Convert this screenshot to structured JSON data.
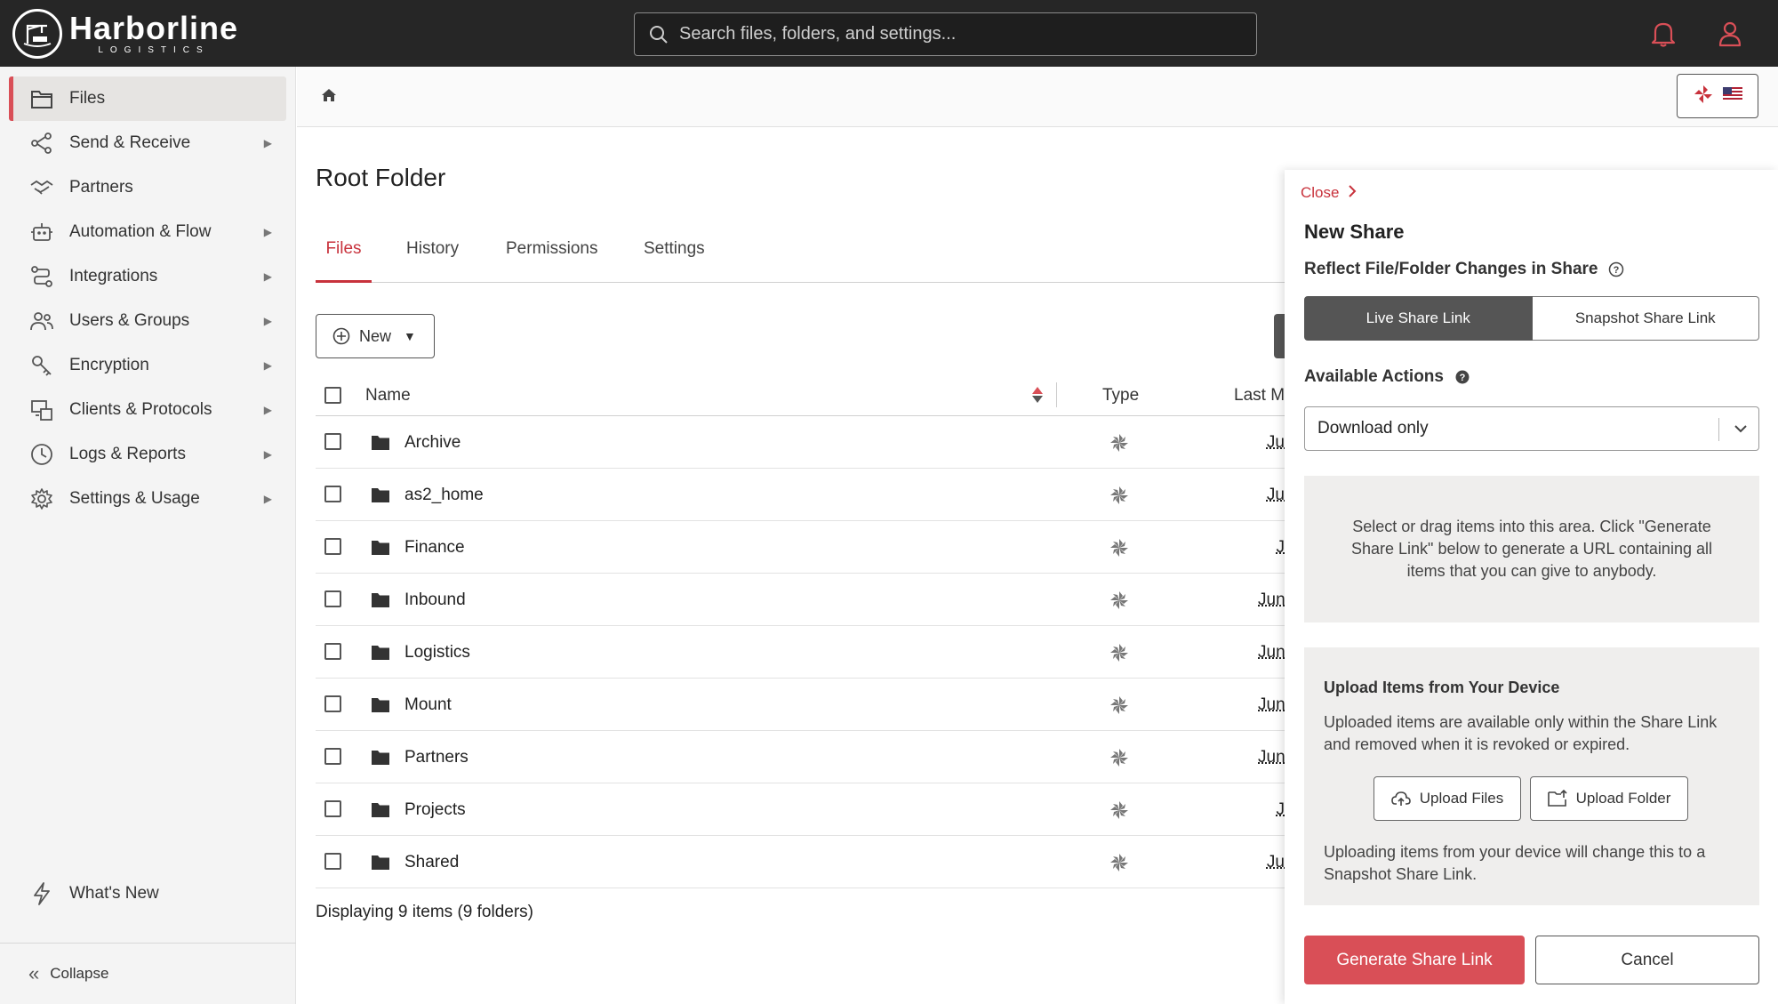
{
  "brand": {
    "name": "Harborline",
    "tagline": "LOGISTICS"
  },
  "search": {
    "placeholder": "Search files, folders, and settings..."
  },
  "header": {
    "icons": [
      "bell-icon",
      "user-icon"
    ],
    "accent": "#d94f57"
  },
  "sidebar": {
    "items": [
      {
        "label": "Files",
        "icon": "folder-icon",
        "active": true,
        "has_arrow": false
      },
      {
        "label": "Send & Receive",
        "icon": "share-nodes-icon",
        "has_arrow": true
      },
      {
        "label": "Partners",
        "icon": "handshake-icon",
        "has_arrow": false
      },
      {
        "label": "Automation & Flow",
        "icon": "robot-icon",
        "has_arrow": true
      },
      {
        "label": "Integrations",
        "icon": "integration-icon",
        "has_arrow": true
      },
      {
        "label": "Users & Groups",
        "icon": "users-icon",
        "has_arrow": true
      },
      {
        "label": "Encryption",
        "icon": "key-icon",
        "has_arrow": true
      },
      {
        "label": "Clients & Protocols",
        "icon": "clients-icon",
        "has_arrow": true
      },
      {
        "label": "Logs & Reports",
        "icon": "clock-icon",
        "has_arrow": true
      },
      {
        "label": "Settings & Usage",
        "icon": "gear-icon",
        "has_arrow": true
      }
    ],
    "whats_new": "What's New",
    "collapse": "Collapse"
  },
  "main": {
    "title": "Root Folder",
    "tabs": [
      {
        "label": "Files",
        "active": true
      },
      {
        "label": "History"
      },
      {
        "label": "Permissions"
      },
      {
        "label": "Settings"
      }
    ],
    "new_button": "New",
    "columns": {
      "name": "Name",
      "type": "Type",
      "last_modified": "Last M"
    },
    "rows": [
      {
        "name": "Archive",
        "date": "Ju"
      },
      {
        "name": "as2_home",
        "date": "Ju"
      },
      {
        "name": "Finance",
        "date": "J"
      },
      {
        "name": "Inbound",
        "date": "Jun"
      },
      {
        "name": "Logistics",
        "date": "Jun"
      },
      {
        "name": "Mount",
        "date": "Jun"
      },
      {
        "name": "Partners",
        "date": "Jun"
      },
      {
        "name": "Projects",
        "date": "J"
      },
      {
        "name": "Shared",
        "date": "Ju"
      }
    ],
    "status": "Displaying 9 items (9 folders)"
  },
  "share_panel": {
    "close": "Close",
    "title": "New Share",
    "reflect_label": "Reflect File/Folder Changes in Share",
    "live_link": "Live Share Link",
    "snapshot_link": "Snapshot Share Link",
    "actions_label": "Available Actions",
    "actions_value": "Download only",
    "dropzone_text": "Select or drag items into this area. Click \"Generate Share Link\" below to generate a URL containing all items that you can give to anybody.",
    "upload_title": "Upload Items from Your Device",
    "upload_desc": "Uploaded items are available only within the Share Link and removed when it is revoked or expired.",
    "upload_files": "Upload Files",
    "upload_folder": "Upload Folder",
    "upload_note": "Uploading items from your device will change this to a Snapshot Share Link.",
    "generate": "Generate Share Link",
    "cancel": "Cancel"
  }
}
